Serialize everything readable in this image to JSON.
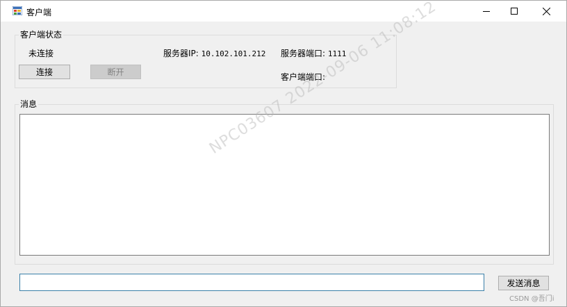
{
  "window": {
    "title": "客户端",
    "controls": {
      "minimize": "–",
      "maximize": "□",
      "close": "✕"
    }
  },
  "status_group": {
    "legend": "客户端状态",
    "state": "未连接",
    "server_ip_label": "服务器IP:",
    "server_ip_value": "10.102.101.212",
    "server_port_label": "服务器端口:",
    "server_port_value": "1111",
    "client_port_label": "客户端端口:",
    "client_port_value": "",
    "connect_button": "连接",
    "disconnect_button": "断开"
  },
  "message_group": {
    "legend": "消息",
    "content": ""
  },
  "send": {
    "input_value": "",
    "button": "发送消息"
  },
  "watermark": "NPC03607  2022-09-06  11:08:12",
  "credit": "CSDN @吾门i",
  "colors": {
    "window_bg": "#f0f0f0",
    "input_focus_border": "#3a7fa8",
    "disabled_text": "#838383"
  },
  "icons": {
    "app": "winforms-app-icon",
    "minimize": "minimize-icon",
    "maximize": "maximize-icon",
    "close": "close-icon"
  }
}
